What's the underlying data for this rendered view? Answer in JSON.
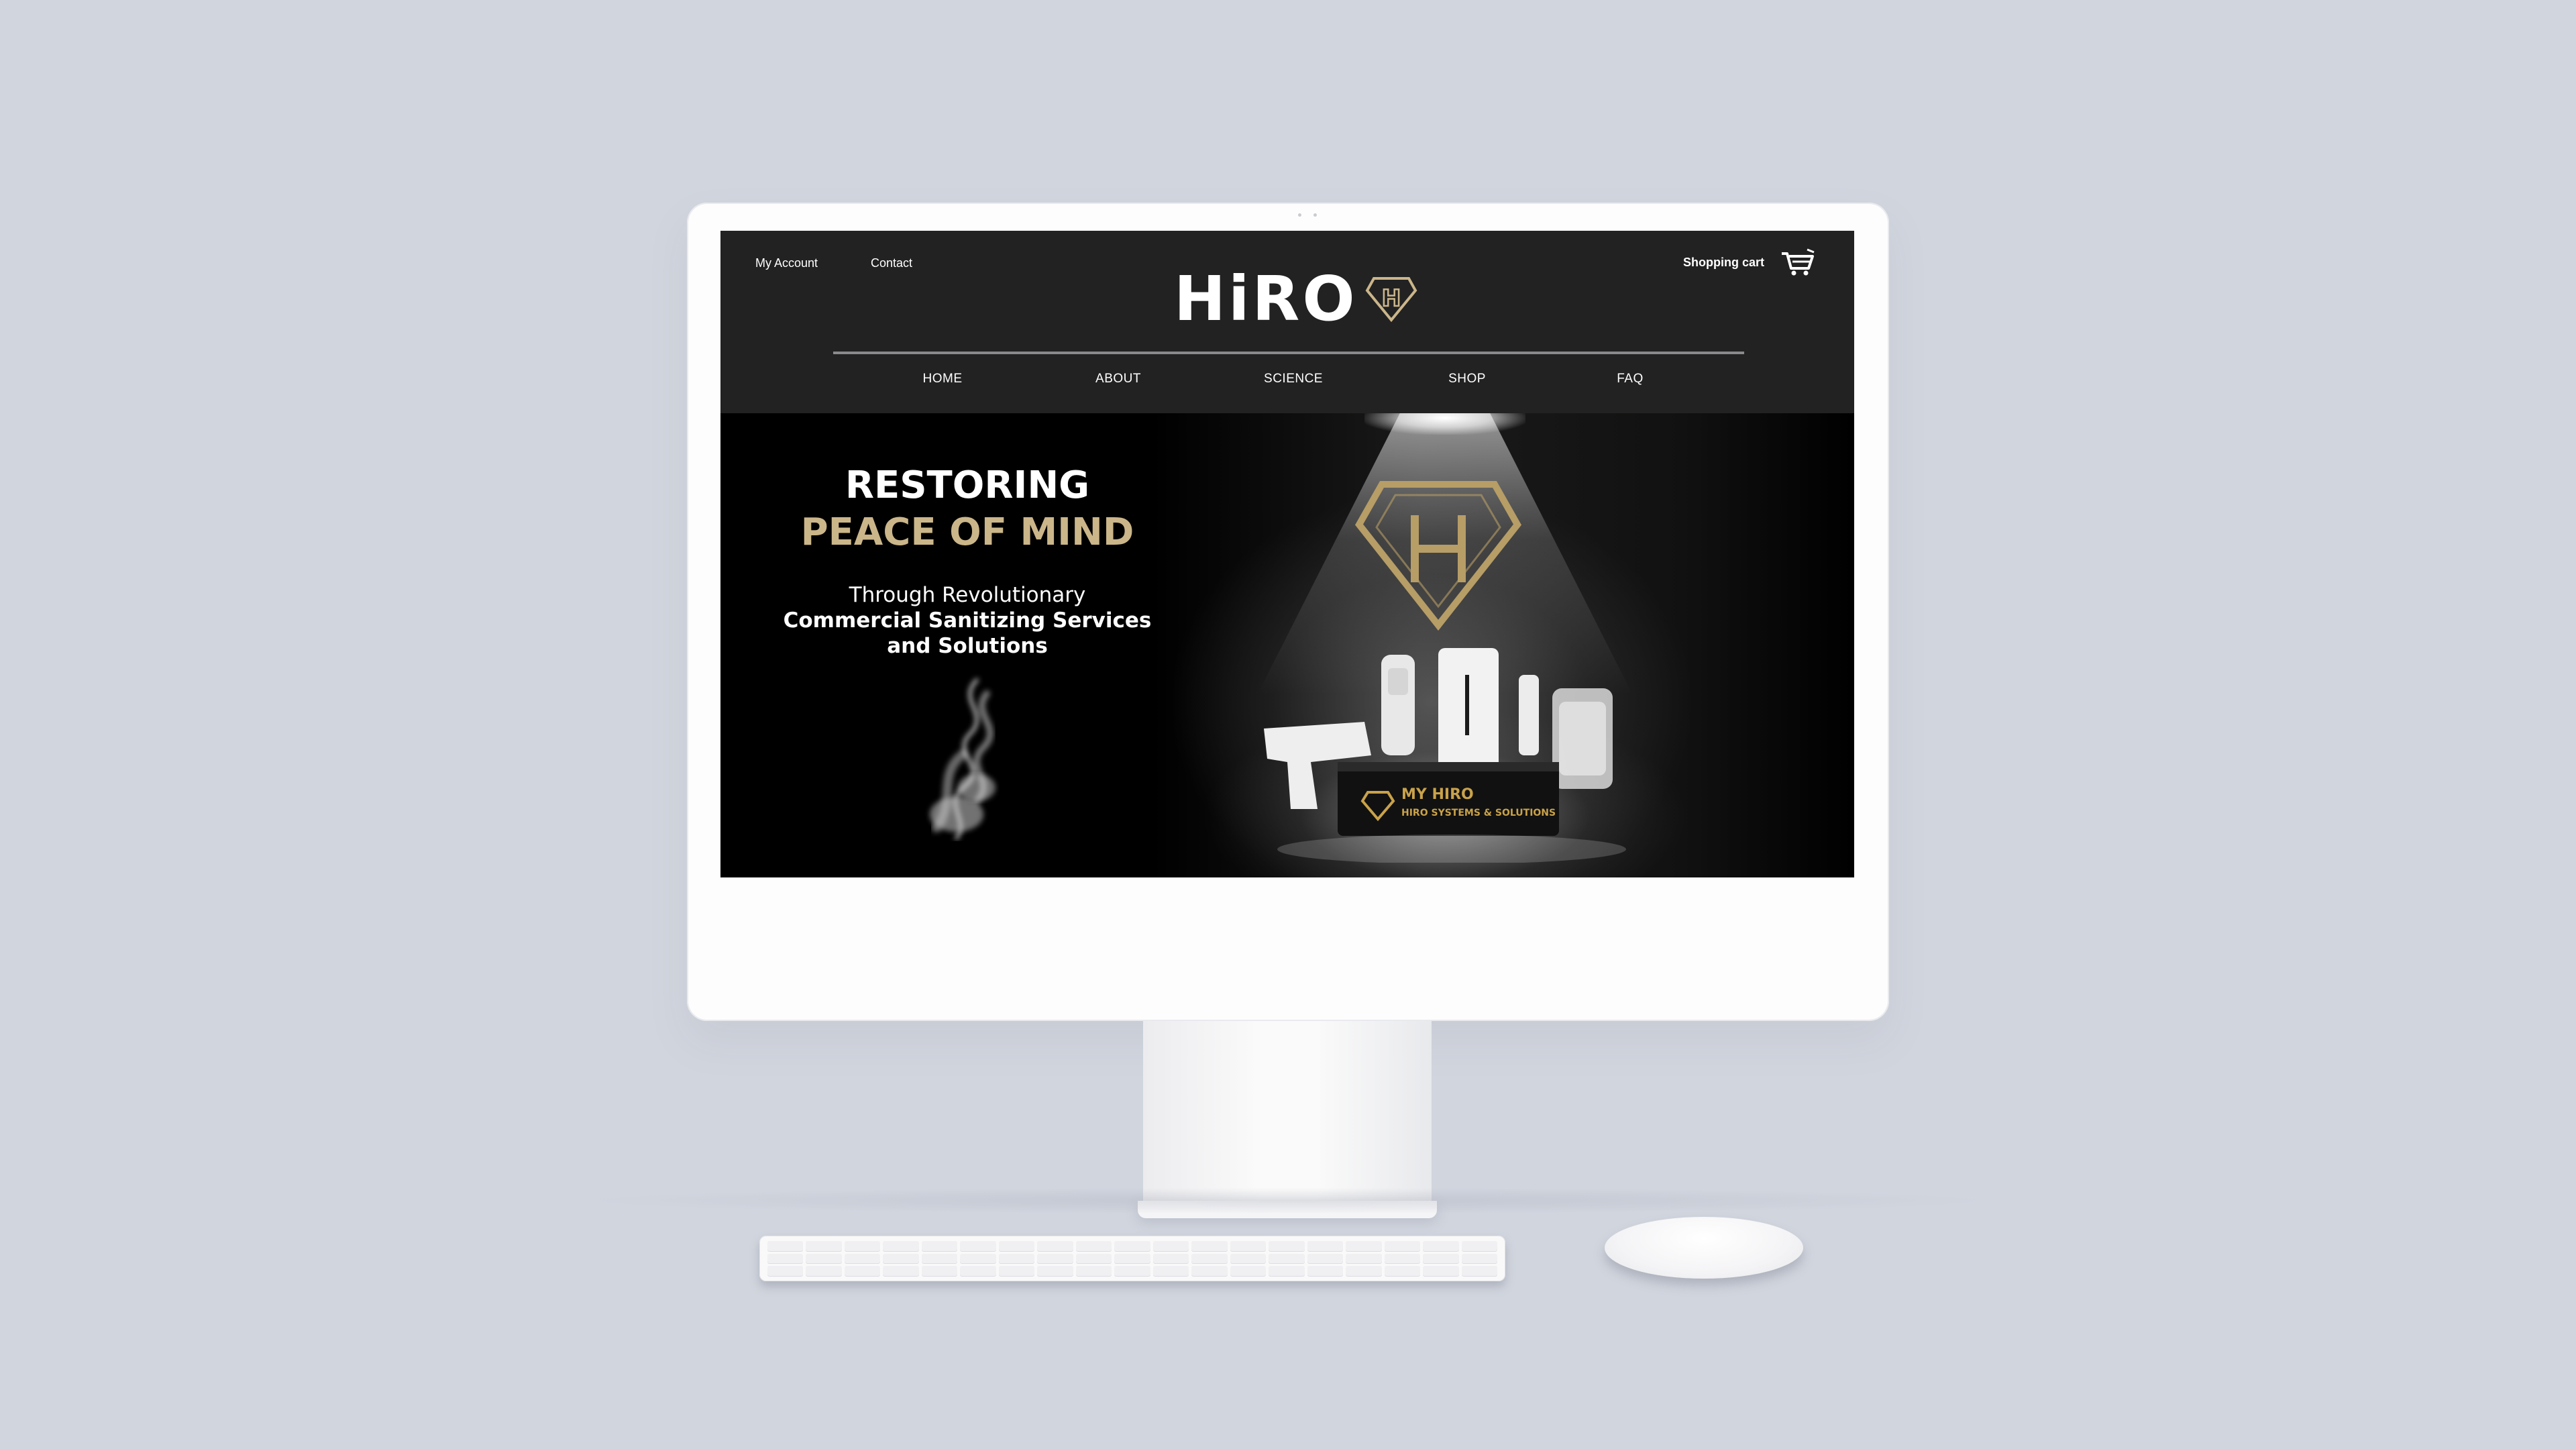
{
  "header": {
    "links": {
      "account": "My Account",
      "contact": "Contact"
    },
    "logo": {
      "text": "HiRO",
      "emblem_letter": "H"
    },
    "cart": {
      "label": "Shopping cart",
      "icon": "cart-icon"
    },
    "nav": [
      {
        "label": "HOME"
      },
      {
        "label": "ABOUT"
      },
      {
        "label": "SCIENCE"
      },
      {
        "label": "SHOP"
      },
      {
        "label": "FAQ"
      }
    ]
  },
  "hero": {
    "headline_1": "RESTORING",
    "headline_2": "PEACE OF MIND",
    "sub_1": "Through Revolutionary",
    "sub_2": "Commercial Sanitizing Services and Solutions",
    "product_box_title": "MY HIRO",
    "product_box_subtitle": "HIRO SYSTEMS & SOLUTIONS"
  },
  "colors": {
    "header_bg": "#222223",
    "accent_gold": "#cbb68a",
    "page_bg": "#d1d5de"
  }
}
